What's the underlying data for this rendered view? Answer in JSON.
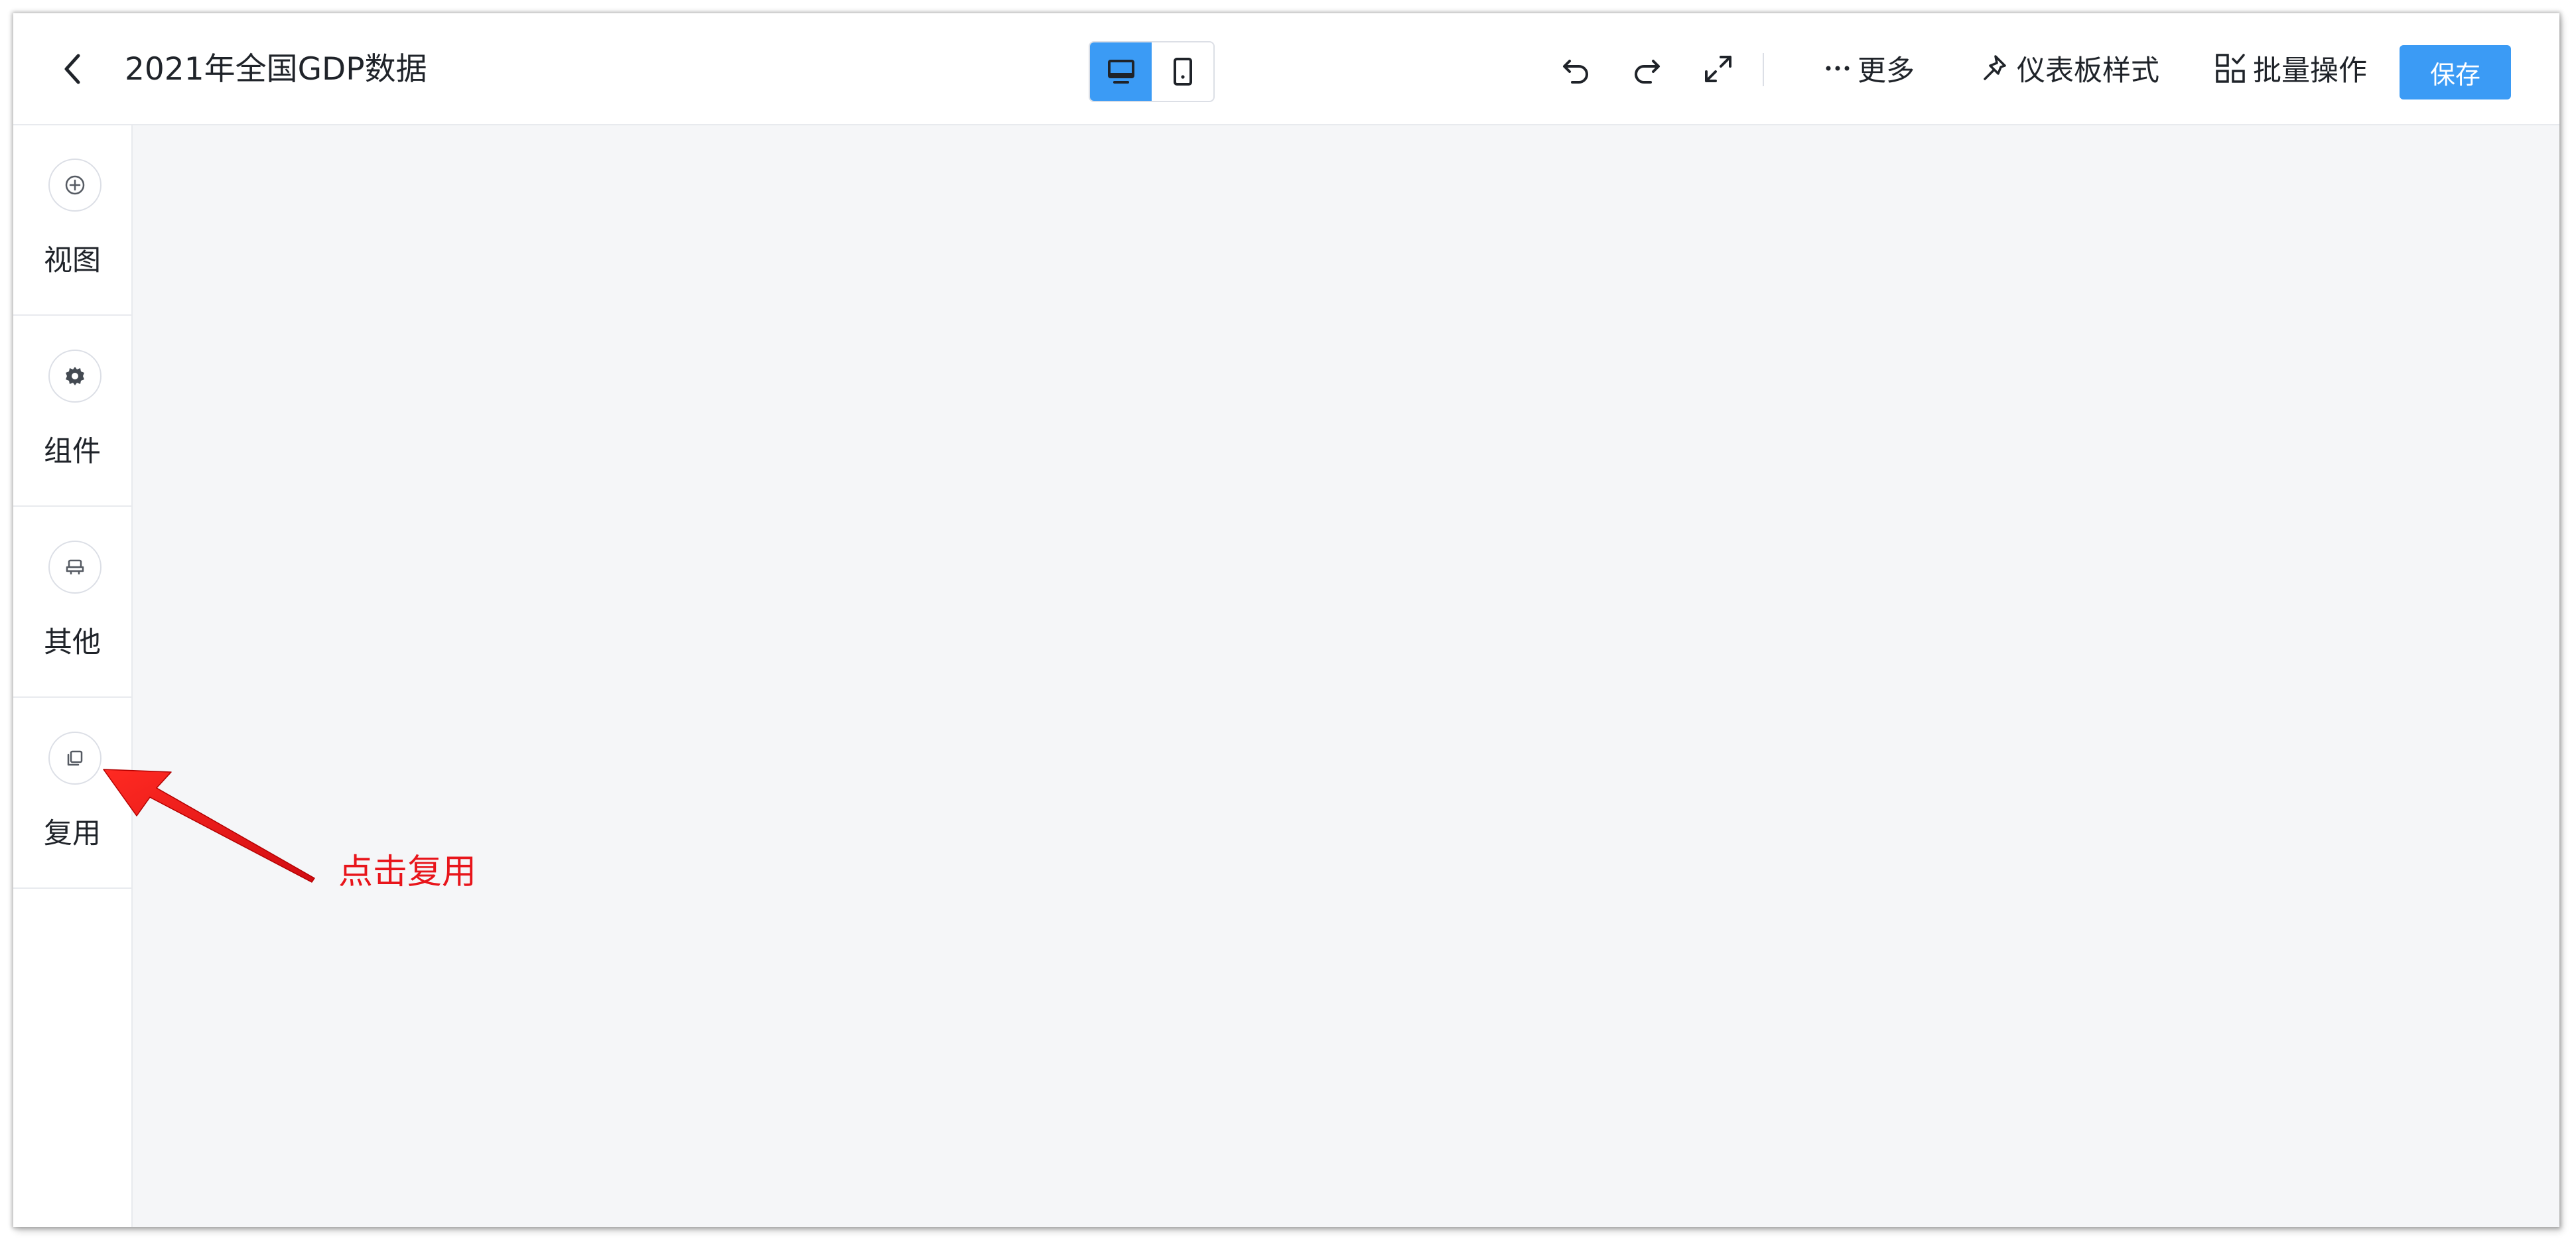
{
  "header": {
    "title": "2021年全国GDP数据",
    "back_icon": "chevron-left-icon",
    "device_modes": [
      {
        "name": "desktop",
        "icon": "monitor-icon",
        "active": true
      },
      {
        "name": "mobile",
        "icon": "tablet-icon",
        "active": false
      }
    ],
    "tools": {
      "undo_icon": "undo-icon",
      "redo_icon": "redo-icon",
      "fullscreen_icon": "expand-icon",
      "more_label": "更多",
      "dashboard_style_label": "仪表板样式",
      "batch_label": "批量操作",
      "save_label": "保存"
    }
  },
  "sidebar": {
    "items": [
      {
        "label": "视图",
        "icon": "plus-circle-icon"
      },
      {
        "label": "组件",
        "icon": "gear-icon"
      },
      {
        "label": "其他",
        "icon": "other-icon"
      },
      {
        "label": "复用",
        "icon": "copy-icon"
      }
    ]
  },
  "annotation": {
    "text": "点击复用"
  },
  "colors": {
    "accent": "#3b9bf5",
    "annotation_red": "#e8151b",
    "canvas_bg": "#f5f6f8",
    "border": "#e8eaee"
  }
}
